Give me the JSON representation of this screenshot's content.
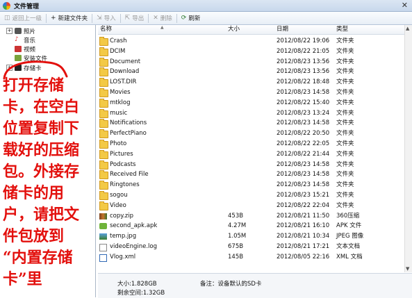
{
  "window": {
    "title": "文件管理",
    "close": "✕"
  },
  "toolbar": {
    "back": "返回上一级",
    "new_folder": "新建文件夹",
    "import": "导入",
    "export": "导出",
    "delete": "删除",
    "refresh": "刷新"
  },
  "tree": {
    "items": [
      {
        "label": "照片",
        "icon": "photo-icon",
        "expandable": true
      },
      {
        "label": "音乐",
        "icon": "music-icon",
        "expandable": false
      },
      {
        "label": "视频",
        "icon": "video-icon",
        "expandable": false
      },
      {
        "label": "安装文件",
        "icon": "install-file-icon",
        "expandable": false
      },
      {
        "label": "存储卡",
        "icon": "sd-card-icon",
        "expandable": true
      }
    ]
  },
  "annotation": {
    "lines": [
      "打开存储",
      "卡，在空白",
      "位置复制下",
      "载好的压缩",
      "包。外接存",
      "储卡的用",
      "户，请把文",
      "件包放到",
      "“内置存储",
      "卡”里"
    ]
  },
  "list": {
    "columns": {
      "name": "名称",
      "size": "大小",
      "date": "日期",
      "type": "类型"
    },
    "rows": [
      {
        "name": "Crash",
        "size": "",
        "date": "2012/08/22 19:06",
        "type": "文件夹",
        "icon": "folder"
      },
      {
        "name": "DCIM",
        "size": "",
        "date": "2012/08/22 21:05",
        "type": "文件夹",
        "icon": "folder"
      },
      {
        "name": "Document",
        "size": "",
        "date": "2012/08/23 13:56",
        "type": "文件夹",
        "icon": "folder"
      },
      {
        "name": "Download",
        "size": "",
        "date": "2012/08/23 13:56",
        "type": "文件夹",
        "icon": "folder"
      },
      {
        "name": "LOST.DIR",
        "size": "",
        "date": "2012/08/22 18:48",
        "type": "文件夹",
        "icon": "folder"
      },
      {
        "name": "Movies",
        "size": "",
        "date": "2012/08/23 14:58",
        "type": "文件夹",
        "icon": "folder"
      },
      {
        "name": "mtklog",
        "size": "",
        "date": "2012/08/22 15:40",
        "type": "文件夹",
        "icon": "folder"
      },
      {
        "name": "music",
        "size": "",
        "date": "2012/08/23 13:24",
        "type": "文件夹",
        "icon": "folder"
      },
      {
        "name": "Notifications",
        "size": "",
        "date": "2012/08/23 14:58",
        "type": "文件夹",
        "icon": "folder"
      },
      {
        "name": "PerfectPiano",
        "size": "",
        "date": "2012/08/22 20:50",
        "type": "文件夹",
        "icon": "folder"
      },
      {
        "name": "Photo",
        "size": "",
        "date": "2012/08/22 22:05",
        "type": "文件夹",
        "icon": "folder"
      },
      {
        "name": "Pictures",
        "size": "",
        "date": "2012/08/22 21:44",
        "type": "文件夹",
        "icon": "folder"
      },
      {
        "name": "Podcasts",
        "size": "",
        "date": "2012/08/23 14:58",
        "type": "文件夹",
        "icon": "folder"
      },
      {
        "name": "Received File",
        "size": "",
        "date": "2012/08/23 14:58",
        "type": "文件夹",
        "icon": "folder"
      },
      {
        "name": "Ringtones",
        "size": "",
        "date": "2012/08/23 14:58",
        "type": "文件夹",
        "icon": "folder"
      },
      {
        "name": "sogou",
        "size": "",
        "date": "2012/08/23 15:21",
        "type": "文件夹",
        "icon": "folder"
      },
      {
        "name": "Video",
        "size": "",
        "date": "2012/08/22 22:04",
        "type": "文件夹",
        "icon": "folder"
      },
      {
        "name": "copy.zip",
        "size": "453B",
        "date": "2012/08/21 11:50",
        "type": "360压缩",
        "icon": "zip"
      },
      {
        "name": "second_apk.apk",
        "size": "4.27M",
        "date": "2012/08/21 16:10",
        "type": "APK 文件",
        "icon": "apk"
      },
      {
        "name": "temp.jpg",
        "size": "1.05M",
        "date": "2012/08/21 10:34",
        "type": "JPEG 图像",
        "icon": "jpg"
      },
      {
        "name": "videoEngine.log",
        "size": "675B",
        "date": "2012/08/21 17:21",
        "type": "文本文档",
        "icon": "doc"
      },
      {
        "name": "Vlog.xml",
        "size": "145B",
        "date": "2012/08/05 22:16",
        "type": "XML 文档",
        "icon": "xml"
      }
    ]
  },
  "status": {
    "size": "大小:1.828GB",
    "free": "剩余空间:1.32GB",
    "note": "备注：设备默认的SD卡"
  }
}
